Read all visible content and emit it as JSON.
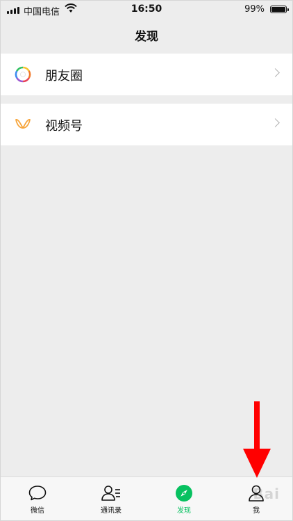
{
  "status_bar": {
    "carrier": "中国电信",
    "time": "16:50",
    "battery_percent": "99%",
    "battery_level": 0.99,
    "signal_bars": 4
  },
  "nav": {
    "title": "发现"
  },
  "cells": [
    {
      "label": "朋友圈",
      "icon": "moments-icon"
    },
    {
      "label": "视频号",
      "icon": "channels-icon"
    }
  ],
  "tabbar": {
    "tabs": [
      {
        "label": "微信",
        "icon": "chat-bubble-icon",
        "active": false
      },
      {
        "label": "通讯录",
        "icon": "contacts-icon",
        "active": false
      },
      {
        "label": "发现",
        "icon": "compass-icon",
        "active": true
      },
      {
        "label": "我",
        "icon": "person-icon",
        "active": false
      }
    ]
  },
  "colors": {
    "accent": "#07c160",
    "annotation_arrow": "#ff0000",
    "background": "#ededed"
  },
  "watermark": "Bai"
}
